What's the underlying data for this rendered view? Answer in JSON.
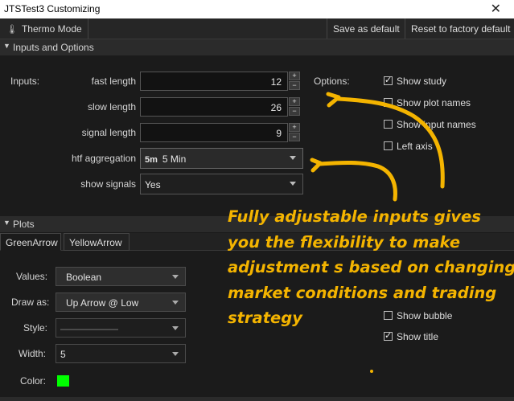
{
  "window": {
    "title": "JTSTest3 Customizing",
    "close_glyph": "✕"
  },
  "toolbar": {
    "thermo_label": "Thermo Mode",
    "save_label": "Save as default",
    "reset_label": "Reset to factory default"
  },
  "inputs_section": {
    "title": "Inputs and Options",
    "inputs_label": "Inputs:",
    "options_label": "Options:",
    "fields": {
      "fast_length": {
        "label": "fast length",
        "value": "12"
      },
      "slow_length": {
        "label": "slow length",
        "value": "26"
      },
      "signal_length": {
        "label": "signal length",
        "value": "9"
      },
      "htf_aggregation": {
        "label": "htf aggregation",
        "tag": "5m",
        "value": "5 Min"
      },
      "show_signals": {
        "label": "show signals",
        "value": "Yes"
      }
    },
    "options": [
      {
        "label": "Show study",
        "checked": true
      },
      {
        "label": "Show plot names",
        "checked": false
      },
      {
        "label": "Show input names",
        "checked": false
      },
      {
        "label": "Left axis",
        "checked": false
      }
    ]
  },
  "plots_section": {
    "title": "Plots",
    "tabs": [
      "GreenArrow",
      "YellowArrow"
    ],
    "active_tab": "GreenArrow",
    "fields": {
      "values": {
        "label": "Values:",
        "value": "Boolean"
      },
      "draw_as": {
        "label": "Draw as:",
        "value": "Up Arrow @ Low"
      },
      "style": {
        "label": "Style:",
        "value": "——————"
      },
      "width": {
        "label": "Width:",
        "value": "5"
      },
      "color": {
        "label": "Color:",
        "value": "#00ff00"
      }
    },
    "options": [
      {
        "label": "Show bubble",
        "checked": false
      },
      {
        "label": "Show title",
        "checked": true
      }
    ]
  },
  "annotation": {
    "lines": [
      "Fully adjustable inputs gives",
      "you the flexibility to make",
      "adjustment s based on changing",
      "market conditions and trading",
      "strategy"
    ],
    "color": "#f4b400"
  }
}
